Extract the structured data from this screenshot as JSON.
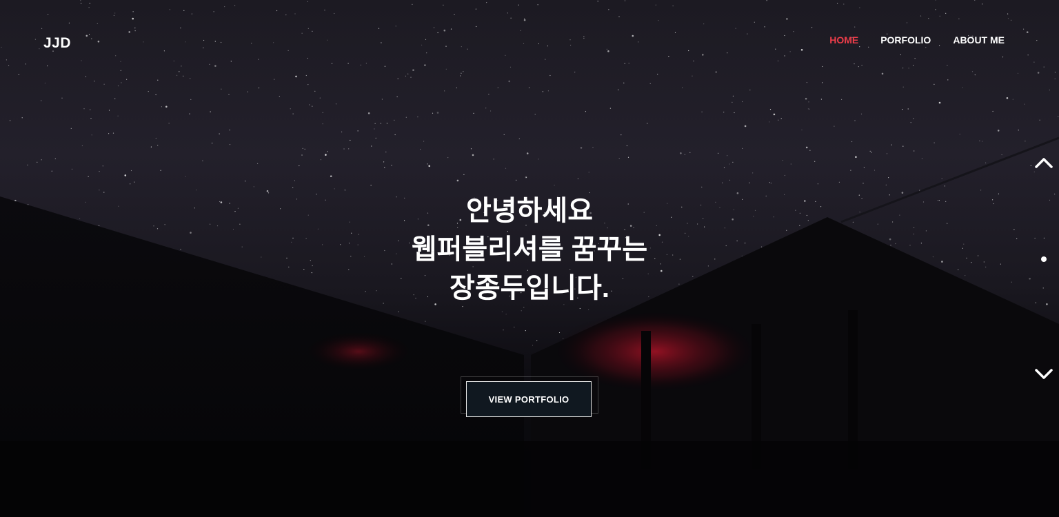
{
  "header": {
    "logo": "JJD",
    "nav": [
      {
        "label": "HOME",
        "active": true
      },
      {
        "label": "PORFOLIO",
        "active": false
      },
      {
        "label": "ABOUT ME",
        "active": false
      }
    ]
  },
  "hero": {
    "lines": [
      "안녕하세요",
      "웹퍼블리셔를 꿈꾸는",
      "장종두입니다."
    ],
    "cta_label": "VIEW PORTFOLIO"
  },
  "side_nav": {
    "up_icon": "chevron-up-icon",
    "dot_icon": "dot-icon",
    "down_icon": "chevron-down-icon"
  },
  "colors": {
    "accent": "#ee3d4a",
    "text": "#ffffff",
    "button_bg": "#101820"
  }
}
